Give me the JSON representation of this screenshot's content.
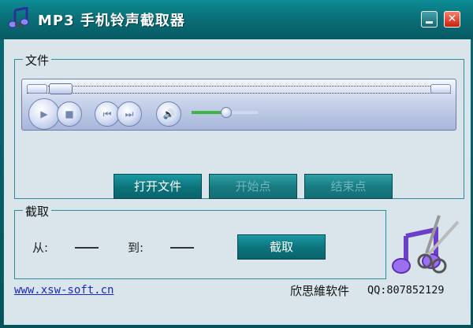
{
  "window": {
    "title": "MP3 手机铃声截取器",
    "minimize_icon": "minimize-icon",
    "close_icon": "close-icon",
    "close_glyph": "✕"
  },
  "file_group": {
    "title": "文件",
    "player": {
      "play_glyph": "▶",
      "stop_glyph": "■",
      "prev_glyph": "⏮",
      "next_glyph": "⏭",
      "mute_glyph": "🔊"
    },
    "buttons": {
      "open": "打开文件",
      "start": "开始点",
      "end": "结束点"
    }
  },
  "cut_group": {
    "title": "截取",
    "from_label": "从:",
    "to_label": "到:",
    "button": "截取"
  },
  "footer": {
    "website": "www.xsw-soft.cn",
    "company": "欣思維软件",
    "qq": "QQ:807852129"
  },
  "colors": {
    "title_bar": "#0a7079",
    "client_bg": "#d9e5ea",
    "button": "#0d757d",
    "link": "#1a27c9"
  }
}
